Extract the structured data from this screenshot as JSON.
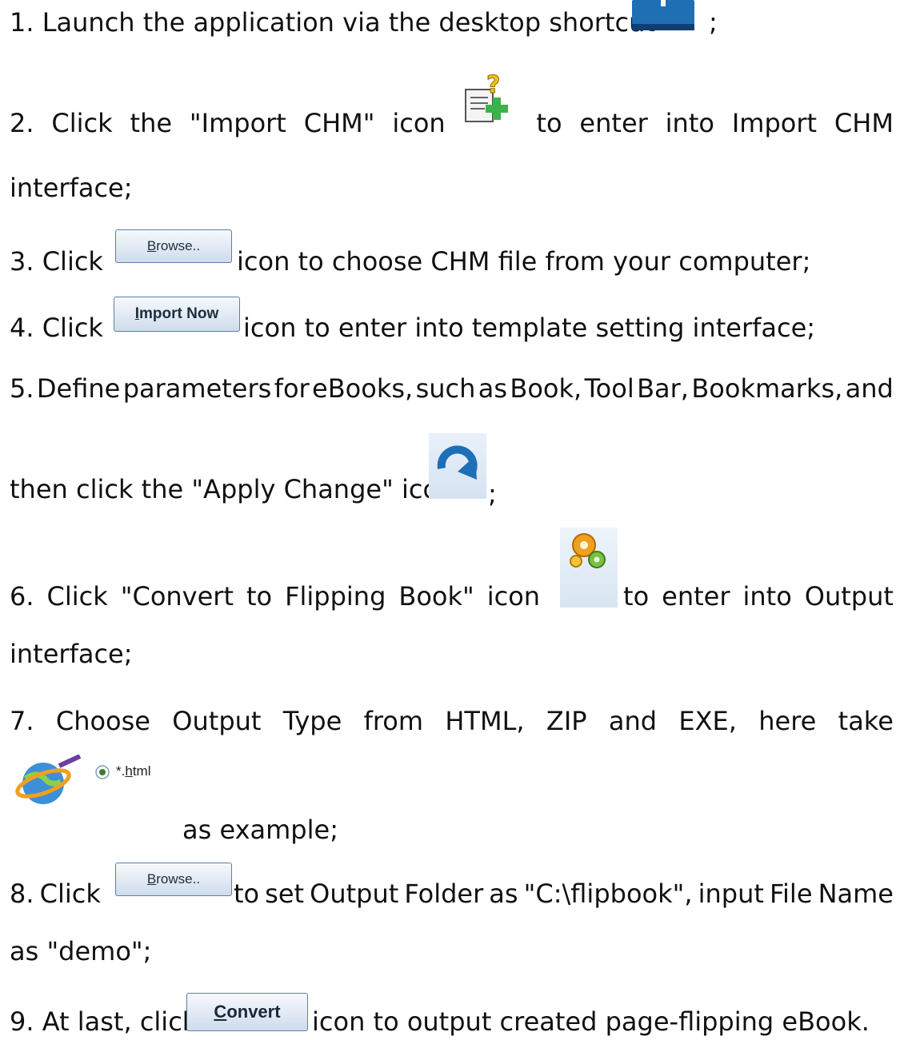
{
  "steps": {
    "s1": {
      "text": "1. Launch the application via the desktop shortcut",
      "end": ";"
    },
    "s2": {
      "w": [
        "2.",
        "Click",
        "the",
        "\"Import",
        "CHM\"",
        "icon",
        "to",
        "enter",
        "into",
        "Import",
        "CHM"
      ],
      "cont": "interface;"
    },
    "s3": {
      "pre": "3. Click",
      "post": "icon to choose CHM file from your computer;"
    },
    "s4": {
      "pre": "4. Click",
      "post": "icon to enter into template setting interface;"
    },
    "s5": {
      "w": [
        "5.",
        "Define",
        "parameters",
        "for",
        "eBooks,",
        "such",
        "as",
        "Book,",
        "Tool",
        "Bar,",
        "Bookmarks,",
        "and"
      ],
      "cont": "then click the \"Apply Change\" icon",
      "end": ";"
    },
    "s6": {
      "w": [
        "6.",
        "Click",
        "\"Convert",
        "to",
        "Flipping",
        "Book\"",
        "icon",
        "to",
        "enter",
        "into",
        "Output"
      ],
      "cont": "interface;"
    },
    "s7": {
      "w": [
        "7.",
        "Choose",
        "Output",
        "Type",
        "from",
        "HTML,",
        "ZIP",
        "and",
        "EXE,",
        "here",
        "take"
      ],
      "radio_prefix": "*.",
      "radio_underlined": "h",
      "radio_suffix": "tml",
      "cont": "as example;"
    },
    "s8": {
      "w": [
        "8.",
        "Click",
        "to",
        "set",
        "Output",
        "Folder",
        "as",
        "\"C:\\flipbook\",",
        "input",
        "File",
        "Name"
      ],
      "cont": "as \"demo\";"
    },
    "s9": {
      "pre": "9. At last, click",
      "post": "icon to output created page-flipping eBook."
    }
  },
  "buttons": {
    "browse_first": "B",
    "browse_rest": "rowse..",
    "import_first": "I",
    "import_rest": "mport Now",
    "convert_first": "C",
    "convert_rest": "onvert"
  },
  "icons": {
    "desktop_shortcut": "book-icon",
    "import_chm": "document-question-plus-icon",
    "apply_change": "refresh-arrow-icon",
    "convert_flipbook": "gears-icon",
    "html_output": "globe-pen-icon"
  },
  "colors": {
    "button_border": "#5d7ea8",
    "accent_blue": "#1e6fb8",
    "plus_green": "#3cb34a",
    "gear_orange": "#f0a020"
  }
}
